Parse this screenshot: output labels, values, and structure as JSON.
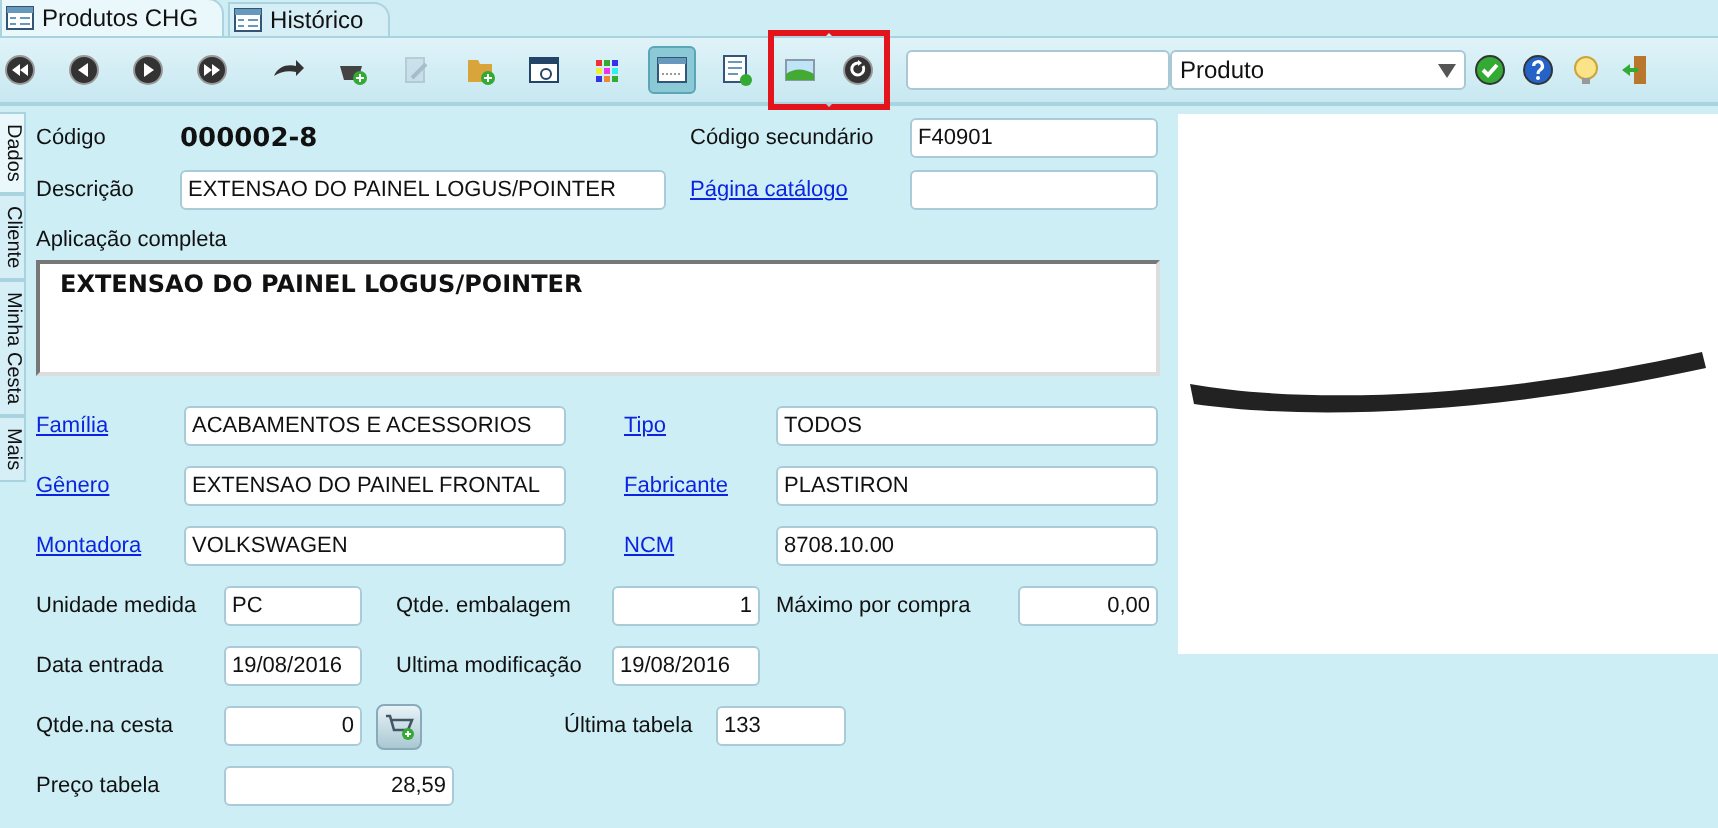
{
  "tabs": [
    {
      "label": "Produtos CHG",
      "selected": true
    },
    {
      "label": "Histórico",
      "selected": false
    }
  ],
  "toolbar": {
    "buttons": [
      {
        "kind": "first",
        "selected": false,
        "disabled": false,
        "highlighted": false
      },
      {
        "kind": "previous",
        "selected": false,
        "disabled": false,
        "highlighted": false
      },
      {
        "kind": "next",
        "selected": false,
        "disabled": false,
        "highlighted": false
      },
      {
        "kind": "last",
        "selected": false,
        "disabled": false,
        "highlighted": false
      },
      {
        "kind": "arrow",
        "selected": false,
        "disabled": false,
        "highlighted": false
      },
      {
        "kind": "basket-add",
        "selected": false,
        "disabled": false,
        "highlighted": false
      },
      {
        "kind": "edit",
        "selected": false,
        "disabled": true,
        "highlighted": false
      },
      {
        "kind": "folder-add",
        "selected": false,
        "disabled": false,
        "highlighted": false
      },
      {
        "kind": "window-search",
        "selected": false,
        "disabled": false,
        "highlighted": false
      },
      {
        "kind": "color-grid",
        "selected": false,
        "disabled": false,
        "highlighted": false
      },
      {
        "kind": "form",
        "selected": true,
        "disabled": false,
        "highlighted": false
      },
      {
        "kind": "list-add",
        "selected": false,
        "disabled": false,
        "highlighted": false
      },
      {
        "kind": "image",
        "selected": false,
        "disabled": false,
        "highlighted": true
      },
      {
        "kind": "refresh",
        "selected": false,
        "disabled": false,
        "highlighted": true
      }
    ],
    "filter": {
      "value": "Produto"
    },
    "actions": [
      {
        "kind": "confirm"
      },
      {
        "kind": "help"
      },
      {
        "kind": "tip"
      },
      {
        "kind": "exit"
      }
    ]
  },
  "side_tabs": [
    {
      "label": "Dados",
      "selected": true
    },
    {
      "label": "Cliente",
      "selected": false
    },
    {
      "label": "Minha Cesta",
      "selected": false
    },
    {
      "label": "Mais",
      "selected": false
    }
  ],
  "form": {
    "top_rows": [
      [
        {
          "label": "Código",
          "link": false,
          "kind": "static",
          "value": "000002-8"
        },
        {
          "label": "Código secundário",
          "link": false,
          "kind": "text",
          "value": "F40901"
        }
      ],
      [
        {
          "label": "Descrição",
          "link": false,
          "kind": "text",
          "value": "EXTENSAO DO PAINEL LOGUS/POINTER"
        },
        {
          "label": "Página catálogo",
          "link": true,
          "kind": "text"
        }
      ]
    ],
    "application": {
      "label": "Aplicação completa",
      "value": "EXTENSAO DO PAINEL LOGUS/POINTER"
    },
    "rows": [
      [
        {
          "label": "Família",
          "link": true,
          "kind": "text",
          "value": "ACABAMENTOS E ACESSORIOS"
        },
        {
          "label": "Tipo",
          "link": true,
          "kind": "text",
          "value": "TODOS"
        }
      ],
      [
        {
          "label": "Gênero",
          "link": true,
          "kind": "text",
          "value": "EXTENSAO DO PAINEL FRONTAL"
        },
        {
          "label": "Fabricante",
          "link": true,
          "kind": "text",
          "value": "PLASTIRON"
        }
      ],
      [
        {
          "label": "Montadora",
          "link": true,
          "kind": "text",
          "value": "VOLKSWAGEN"
        },
        {
          "label": "NCM",
          "link": true,
          "kind": "text",
          "value": "8708.10.00"
        }
      ],
      [
        {
          "label": "Unidade medida",
          "link": false,
          "kind": "text",
          "value": "PC"
        },
        {
          "label": "Qtde. embalagem",
          "link": false,
          "kind": "number",
          "value": "1"
        },
        {
          "label": "Máximo por compra",
          "link": false,
          "kind": "number",
          "value": "0,00"
        }
      ],
      [
        {
          "label": "Data entrada",
          "link": false,
          "kind": "text",
          "value": "19/08/2016"
        },
        {
          "label": "Ultima modificação",
          "link": false,
          "kind": "text",
          "value": "19/08/2016"
        }
      ],
      [
        {
          "label": "Qtde.na cesta",
          "link": false,
          "kind": "number",
          "value": "0",
          "cart_button": true
        },
        {
          "label": "Última tabela",
          "link": false,
          "kind": "text",
          "value": "133"
        }
      ],
      [
        {
          "label": "Preço tabela",
          "link": false,
          "kind": "number",
          "value": "28,59"
        }
      ]
    ]
  }
}
